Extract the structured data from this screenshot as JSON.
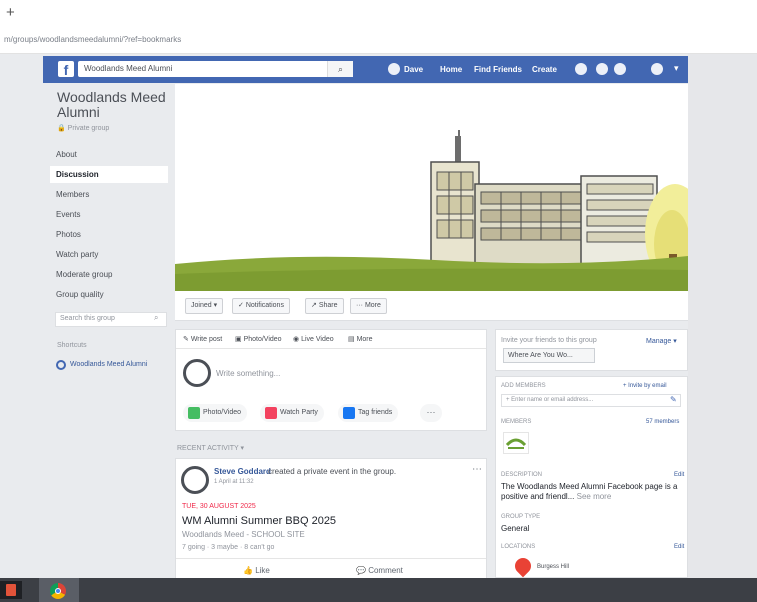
{
  "browser": {
    "new_tab": "+",
    "url": "m/groups/woodlandsmeedalumni/?ref=bookmarks"
  },
  "topbar": {
    "logo": "f",
    "search_value": "Woodlands Meed Alumni",
    "search_icon": "search-icon",
    "nav": [
      "Dave",
      "Home",
      "Find Friends",
      "Create"
    ]
  },
  "sidebar": {
    "title": "Woodlands Meed Alumni",
    "group_type": "Private group",
    "items": [
      "About",
      "Discussion",
      "Members",
      "Events",
      "Photos",
      "Watch party",
      "Moderate group",
      "Group quality"
    ],
    "active_index": 1,
    "search_placeholder": "Search this group",
    "shortcuts_label": "Shortcuts",
    "shortcut": "Woodlands Meed Alumni"
  },
  "cover_actions": {
    "joined": "Joined",
    "notifications": "Notifications",
    "share": "Share",
    "more": "More"
  },
  "composer": {
    "tabs": [
      "Write post",
      "Photo/Video",
      "Live Video",
      "More"
    ],
    "placeholder": "Write something...",
    "buttons": [
      "Photo/Video",
      "Watch Party",
      "Tag friends"
    ],
    "more_label": "···"
  },
  "recent_label": "RECENT ACTIVITY",
  "post": {
    "author": "Steve Goddard",
    "action": "created a private event in the group.",
    "time": "1 April at 11:32",
    "event_date": "TUE, 30 AUGUST 2025",
    "event_title": "WM Alumni Summer BBQ 2025",
    "event_location": "Woodlands Meed - SCHOOL SITE",
    "event_stats": "7 going · 3 maybe · 8 can't go",
    "like": "Like",
    "comment": "Comment"
  },
  "right": {
    "manage_hint": "Invite your friends to this group",
    "manage": "Manage",
    "where_btn": "Where Are You Wo...",
    "add_members": "ADD MEMBERS",
    "invite_by_email": "+ Invite by email",
    "invite_placeholder": "+ Enter name or email address...",
    "members_h": "MEMBERS",
    "members_count": "57 members",
    "desc_h": "DESCRIPTION",
    "edit": "Edit",
    "desc": "The Woodlands Meed Alumni Facebook page is a positive and friendl...",
    "see_more": "See more",
    "gtype_h": "GROUP TYPE",
    "gtype_val": "General",
    "location_h": "LOCATIONS",
    "location_text": "Burgess Hill"
  },
  "colors": {
    "fb_blue": "#4267b2",
    "link_blue": "#365899",
    "event_red": "#f02849",
    "background": "#e9ebee"
  }
}
